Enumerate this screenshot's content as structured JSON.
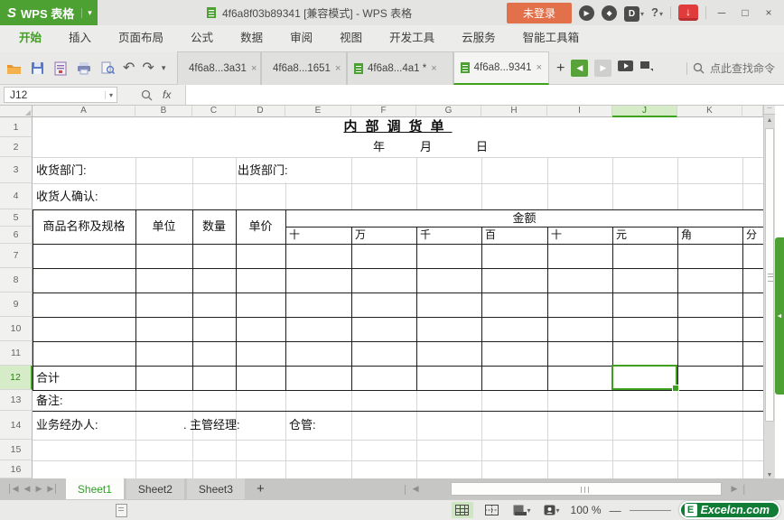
{
  "titlebar": {
    "logo_letter": "S",
    "app_name": "WPS 表格",
    "document_title": "4f6a8f03b89341 [兼容模式] - WPS 表格",
    "login_label": "未登录"
  },
  "menubar": {
    "items": [
      {
        "label": "开始",
        "active": true
      },
      {
        "label": "插入"
      },
      {
        "label": "页面布局"
      },
      {
        "label": "公式"
      },
      {
        "label": "数据"
      },
      {
        "label": "审阅"
      },
      {
        "label": "视图"
      },
      {
        "label": "开发工具"
      },
      {
        "label": "云服务"
      },
      {
        "label": "智能工具箱"
      }
    ]
  },
  "toolbar": {
    "doc_tabs": [
      {
        "label": "4f6a8...3a31",
        "active": false
      },
      {
        "label": "4f6a8...1651",
        "active": false
      },
      {
        "label": "4f6a8...4a1 *",
        "active": false
      },
      {
        "label": "4f6a8...9341",
        "active": true
      }
    ],
    "search_label": "点此查找命令"
  },
  "formula_bar": {
    "name_box": "J12",
    "fx_label": "fx",
    "formula_value": ""
  },
  "grid": {
    "columns": [
      "A",
      "B",
      "C",
      "D",
      "E",
      "F",
      "G",
      "H",
      "I",
      "J",
      "K"
    ],
    "rows": [
      "1",
      "2",
      "3",
      "4",
      "5",
      "6",
      "7",
      "8",
      "9",
      "10",
      "11",
      "12",
      "13",
      "14",
      "15",
      "16"
    ],
    "selected_cell": "J12",
    "title": "内部调货单",
    "date": [
      "年",
      "月",
      "日"
    ],
    "cells": {
      "receive_dept": "收货部门:",
      "ship_dept": "出货部门:",
      "receiver_confirm": "收货人确认:",
      "product_header": "商品名称及规格",
      "unit": "单位",
      "qty": "数量",
      "price": "单价",
      "amount": "金额",
      "digits": [
        "十",
        "万",
        "千",
        "百",
        "十",
        "元",
        "角",
        "分"
      ],
      "total": "合计",
      "remarks": "备注:",
      "handler": "业务经办人:",
      "stray_dot": ".",
      "manager": "主管经理:",
      "warehouse": "仓管:"
    }
  },
  "sheetbar": {
    "tabs": [
      {
        "label": "Sheet1",
        "active": true
      },
      {
        "label": "Sheet2",
        "active": false
      },
      {
        "label": "Sheet3",
        "active": false
      }
    ]
  },
  "statusbar": {
    "zoom_level": "100 %",
    "logo_letter": "E",
    "logo_text": "Excelcn.com"
  },
  "icons": {
    "close": "×",
    "caret_down": "▾",
    "undo": "↶",
    "redo": "↷",
    "plus": "+",
    "back": "◀",
    "forward": "▶",
    "play": "▶",
    "minimize": "─",
    "maximize": "□",
    "help": "?",
    "diamond": "◆",
    "d_badge": "D",
    "down_arrow": "↓",
    "select_all_triangle": "◢",
    "scroll_up": "▲",
    "scroll_down": "▼",
    "scroll_left": "◀",
    "scroll_right": "▶",
    "nav_first": "│◀",
    "nav_prev": "◀",
    "nav_next": "▶",
    "nav_last": "▶│",
    "panel_arrow": "◄",
    "split_handle": "─",
    "sep": "│",
    "zoom_minus": "—"
  }
}
